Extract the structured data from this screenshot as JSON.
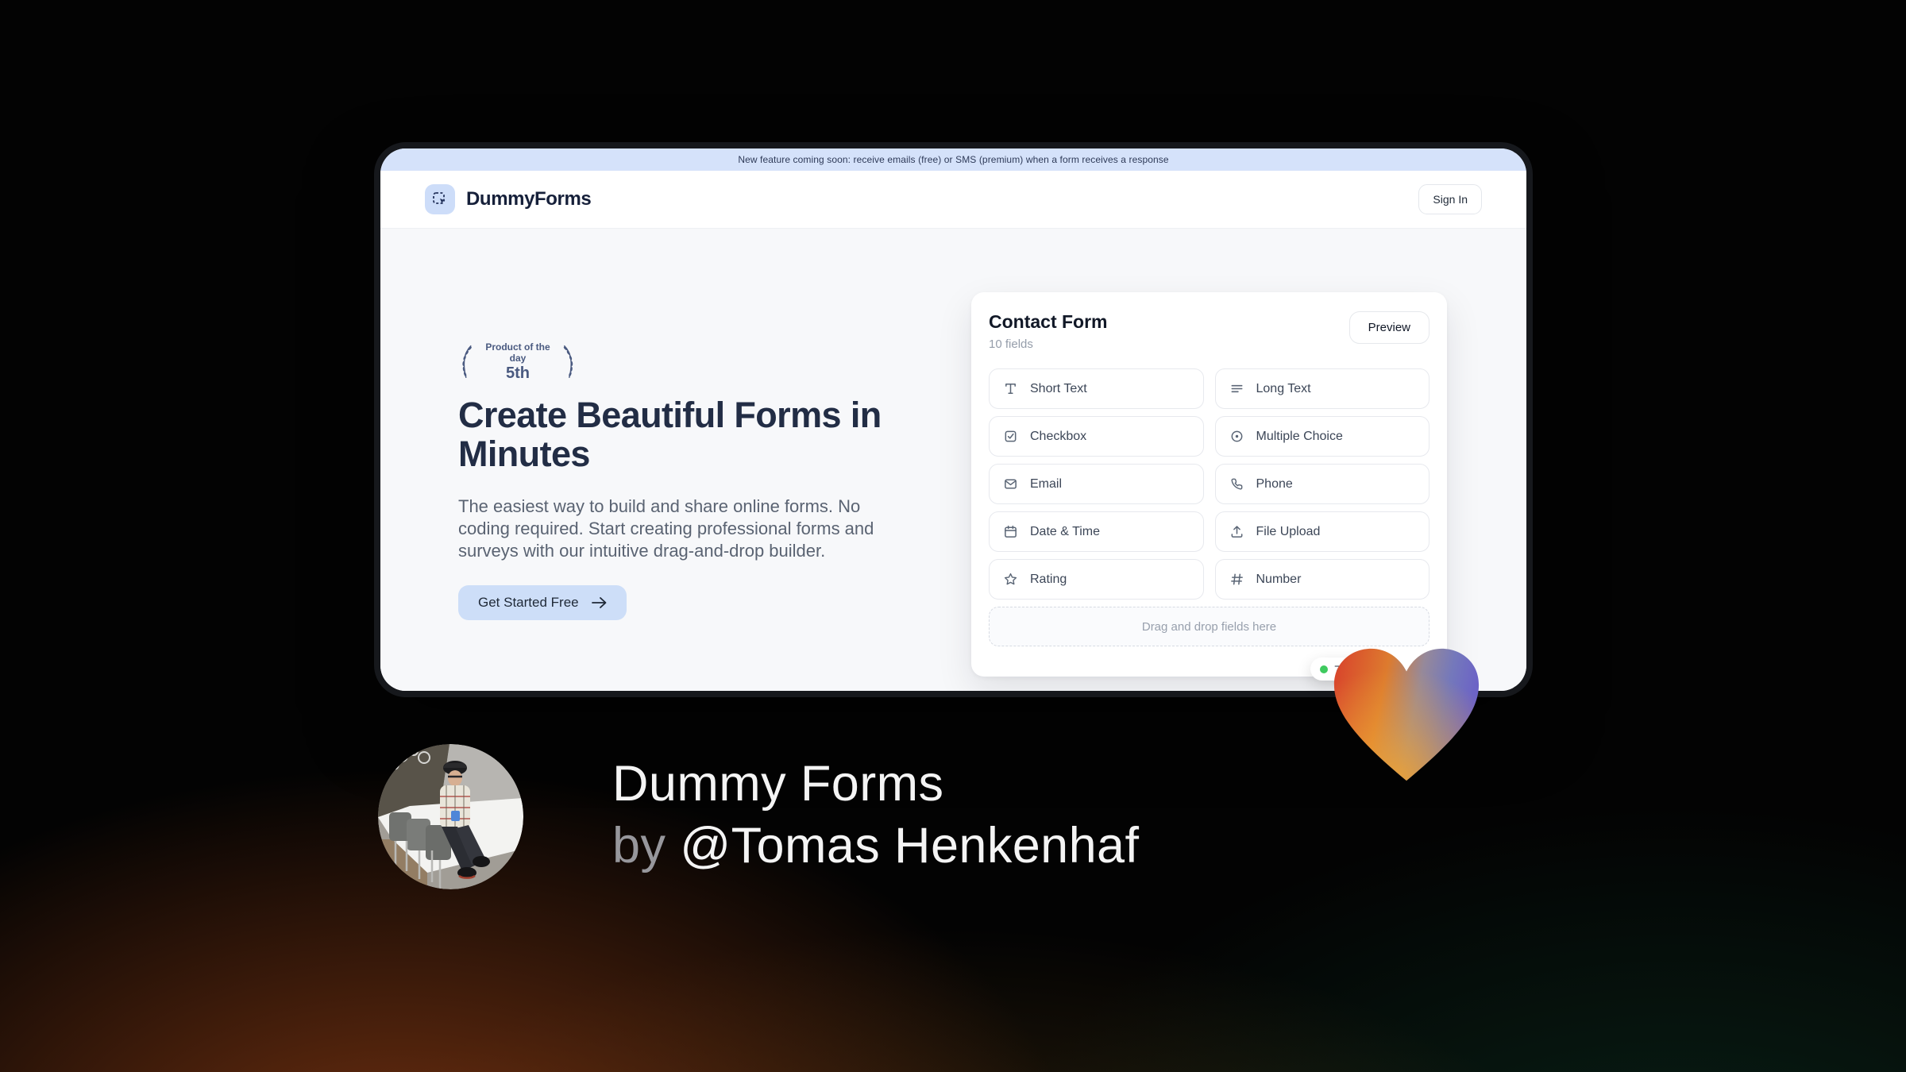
{
  "banner": {
    "text": "New feature coming soon: receive emails (free) or SMS (premium) when a form receives a response"
  },
  "header": {
    "brand": "DummyForms",
    "sign_in_label": "Sign In"
  },
  "hero": {
    "badge": {
      "line1": "Product of the day",
      "line2": "5th"
    },
    "title": "Create Beautiful Forms in\nMinutes",
    "description": "The easiest way to build and share online forms. No coding required. Start creating professional forms and surveys with our intuitive drag-and-drop builder.",
    "cta_label": "Get Started Free"
  },
  "form_card": {
    "title": "Contact Form",
    "subtitle": "10 fields",
    "preview_label": "Preview",
    "fields": [
      {
        "label": "Short Text",
        "icon": "short-text-icon"
      },
      {
        "label": "Long Text",
        "icon": "long-text-icon"
      },
      {
        "label": "Checkbox",
        "icon": "checkbox-icon"
      },
      {
        "label": "Multiple Choice",
        "icon": "multiple-choice-icon"
      },
      {
        "label": "Email",
        "icon": "email-icon"
      },
      {
        "label": "Phone",
        "icon": "phone-icon"
      },
      {
        "label": "Date & Time",
        "icon": "calendar-icon"
      },
      {
        "label": "File Upload",
        "icon": "upload-icon"
      },
      {
        "label": "Rating",
        "icon": "star-icon"
      },
      {
        "label": "Number",
        "icon": "hash-icon"
      }
    ],
    "dropzone_text": "Drag and drop fields here",
    "notification_badge": {
      "visible_text": "77",
      "dot_color": "#3fca5f"
    }
  },
  "credit": {
    "title": "Dummy Forms",
    "byline_prefix": "by",
    "byline_handle": "@Tomas Henkenhaf"
  },
  "colors": {
    "banner_bg": "#d5e2fa",
    "accent_blue": "#cddef8",
    "brand_navy": "#16203a",
    "laurel_navy": "#4a5a80",
    "status_green": "#3fca5f",
    "heart_red": "#d8402c",
    "heart_orange": "#e9992e",
    "heart_purple": "#6c63c6",
    "bg_brown": "#7c3512",
    "bg_green": "#0f422c"
  }
}
